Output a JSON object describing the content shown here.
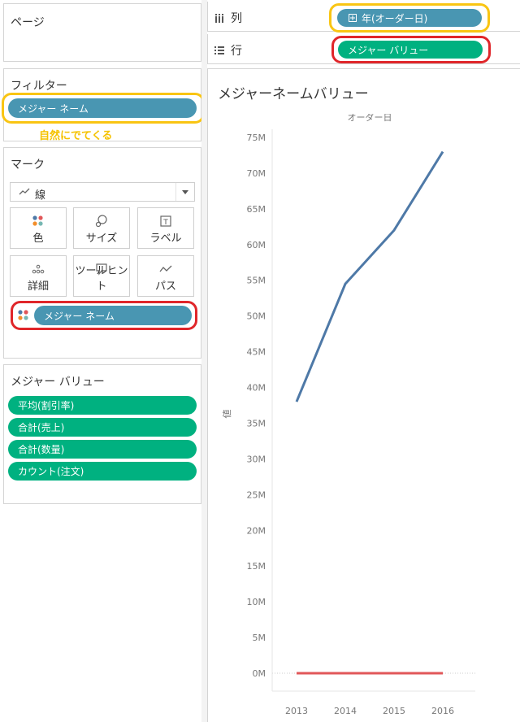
{
  "left": {
    "pages": {
      "title": "ページ"
    },
    "filters": {
      "title": "フィルター",
      "pill": "メジャー ネーム",
      "annotation": "自然にでてくる"
    },
    "marks": {
      "title": "マーク",
      "type_select": "線",
      "buttons": [
        {
          "label": "色",
          "icon": "color-icon"
        },
        {
          "label": "サイズ",
          "icon": "size-icon"
        },
        {
          "label": "ラベル",
          "icon": "label-icon"
        },
        {
          "label": "詳細",
          "icon": "detail-icon"
        },
        {
          "label": "ツールヒント",
          "icon": "tooltip-icon"
        },
        {
          "label": "パス",
          "icon": "path-icon"
        }
      ],
      "color_pill": "メジャー ネーム"
    },
    "measure_values": {
      "title": "メジャー バリュー",
      "items": [
        "平均(割引率)",
        "合計(売上)",
        "合計(数量)",
        "カウント(注文)"
      ]
    }
  },
  "shelves": {
    "columns": {
      "label": "列",
      "pill": "年(オーダー日)"
    },
    "rows": {
      "label": "行",
      "pill": "メジャー バリュー"
    }
  },
  "colors": {
    "blue_pill": "#4996b2",
    "green_pill": "#00b180",
    "highlight_yellow": "#f9c513",
    "highlight_red": "#e0262a"
  },
  "chart_data": {
    "type": "line",
    "title": "メジャーネームバリュー",
    "subtitle": "オーダー日",
    "ylabel": "値",
    "x": [
      "2013",
      "2014",
      "2015",
      "2016"
    ],
    "ylim": [
      0,
      75000000
    ],
    "yticks": [
      "0M",
      "5M",
      "10M",
      "15M",
      "20M",
      "25M",
      "30M",
      "35M",
      "40M",
      "45M",
      "50M",
      "55M",
      "60M",
      "65M",
      "70M",
      "75M"
    ],
    "series": [
      {
        "color": "#4e79a7",
        "values": [
          38000000,
          54500000,
          62000000,
          73000000
        ]
      },
      {
        "color": "#e15759",
        "values": [
          0,
          0,
          0,
          0
        ]
      }
    ]
  }
}
